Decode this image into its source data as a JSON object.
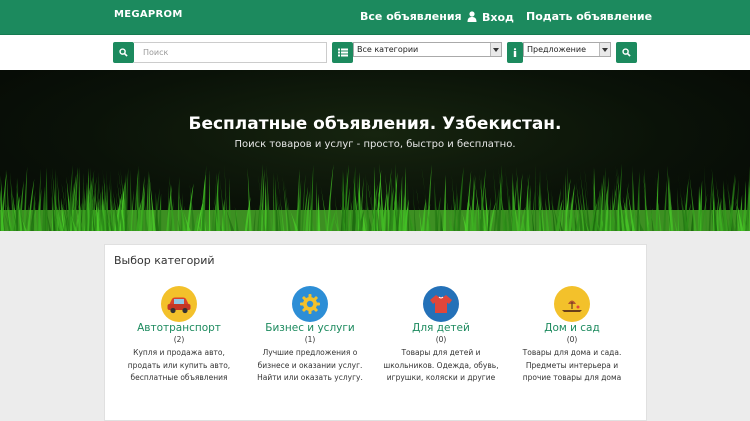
{
  "header": {
    "logo": "MEGAPROM",
    "nav": {
      "all_ads": "Все объявления",
      "login": "Вход",
      "post_ad": "Подать объявление"
    }
  },
  "search": {
    "placeholder": "Поиск",
    "category_select": "Все категории",
    "type_select": "Предложение"
  },
  "hero": {
    "title": "Бесплатные объявления. Узбекистан.",
    "subtitle": "Поиск товаров и услуг - просто, быстро и бесплатно."
  },
  "categories": {
    "title": "Выбор категорий",
    "items": [
      {
        "name": "Автотранспорт",
        "count": "(2)",
        "description": "Купля и продажа авто, продать или купить авто, бесплатные объявления",
        "icon": "car-icon",
        "color": "#f3c12b"
      },
      {
        "name": "Бизнес и услуги",
        "count": "(1)",
        "description": "Лучшие предложения о бизнесе и оказании услуг. Найти или оказать услугу.",
        "icon": "gear-icon",
        "color": "#2d8ed6"
      },
      {
        "name": "Для детей",
        "count": "(0)",
        "description": "Товары для детей и школьников. Одежда, обувь, игрушки, коляски и другие",
        "icon": "child-clothes-icon",
        "color": "#2471b8"
      },
      {
        "name": "Дом и сад",
        "count": "(0)",
        "description": "Товары для дома и сада. Предметы интерьера и прочие товары для дома",
        "icon": "garden-icon",
        "color": "#f3c12b"
      }
    ]
  },
  "colors": {
    "brand": "#1c8a5e",
    "hero_bg": "#0a1208",
    "grass": "#4fb42a"
  }
}
